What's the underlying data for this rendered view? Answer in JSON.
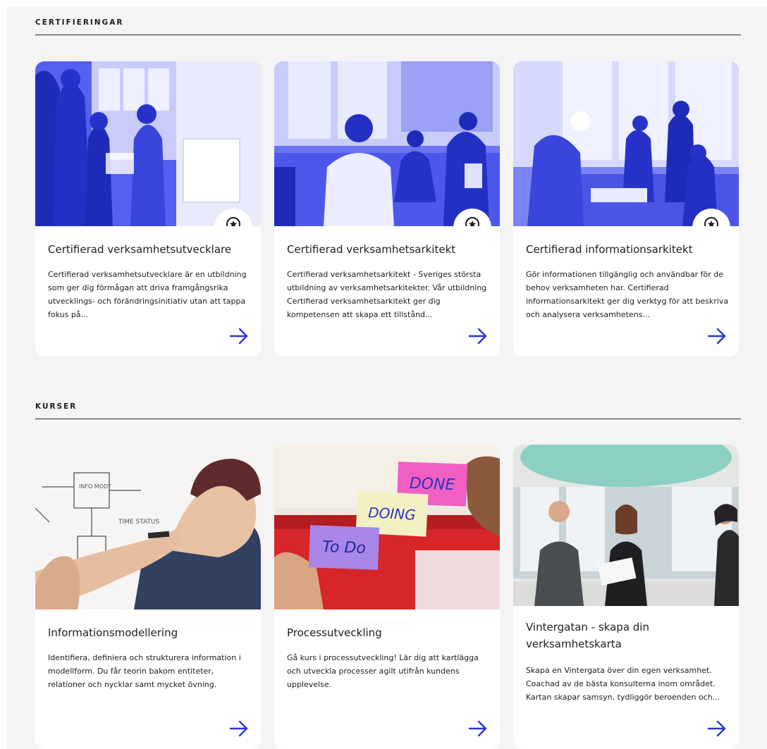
{
  "sections": {
    "certifications": {
      "title": "CERTIFIERINGAR",
      "cards": [
        {
          "title": "Certifierad verksamhetsutvecklare",
          "description": "Certifierad verksamhetsutvecklare är en utbildning som ger dig förmågan att driva framgångsrika utvecklings- och förändringsinitiativ utan att tappa fokus på..."
        },
        {
          "title": "Certifierad verksamhetsarkitekt",
          "description": "Certifierad verksamhetsarkitekt - Sveriges största utbildning av verksamhetsarkitekter. Vår utbildning Certifierad verksamhetsarkitekt ger dig kompetensen att skapa ett tillstånd..."
        },
        {
          "title": "Certifierad informationsarkitekt",
          "description": "Gör informationen tillgänglig och användbar för de behov verksamheten har. Certifierad informationsarkitekt ger dig verktyg för att beskriva och analysera verksamhetens..."
        }
      ]
    },
    "courses": {
      "title": "KURSER",
      "cards": [
        {
          "title": "Informationsmodellering",
          "description": "Identifiera, definiera och strukturera information i modellform. Du får teorin bakom entiteter, relationer och nycklar samt mycket övning."
        },
        {
          "title": "Processutveckling",
          "description": "Gå kurs i processutveckling! Lär dig att kartlägga och utveckla processer agilt utifrån kundens upplevelse."
        },
        {
          "title": "Vintergatan - skapa din verksamhetskarta",
          "description": "Skapa en Vintergata över din egen verksamhet. Coachad av de bästa konsulterna inom området. Kartan skapar samsyn, tydliggör beroenden och..."
        }
      ]
    }
  },
  "sticky_notes": {
    "done": "DONE",
    "doing": "DOING",
    "todo": "To Do"
  },
  "icons": {
    "badge": "award-ribbon-icon",
    "arrow": "arrow-right-icon"
  },
  "colors": {
    "accent": "#2b35d8",
    "duotone": "#4a55ee",
    "background": "#f4f4f4",
    "card": "#ffffff"
  }
}
